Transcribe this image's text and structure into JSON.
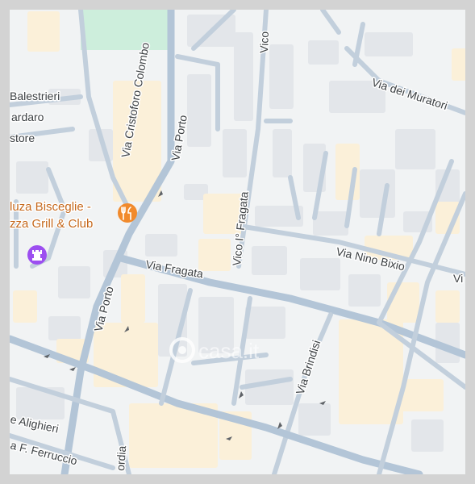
{
  "map": {
    "colors": {
      "background": "#f1f3f4",
      "park": "#cdeedc",
      "road": "#b3c5d7",
      "building": "#e3e6ea",
      "building_warm": "#fbf0d9",
      "poi_restaurant": "#f18a2c",
      "poi_purple": "#9c4ef0",
      "label": "#3c4043",
      "poi_label": "#c5681c",
      "frame": "#d3d3d3"
    },
    "streets": {
      "balestrieri": "Balestrieri",
      "cristoforo_colombo": "Via Cristoforo Colombo",
      "bardaro": "ardaro",
      "store": "store",
      "via_porto_upper": "Via Porto",
      "via_porto_lower": "Via Porto",
      "vico_upper": "Vico",
      "vico_fragata": "Vico I° Fragata",
      "via_dei_muratori": "Via dei Muratori",
      "via_fragata": "Via Fragata",
      "via_nino_bixio": "Via Nino Bixio",
      "right_edge_v": "Vi",
      "via_brindisi": "Via Brindisi",
      "alighieri": "e Alighieri",
      "ferruccio": "a F. Ferruccio",
      "cordia": "ordia"
    },
    "pois": {
      "restaurant_line1": "luza Bisceglie -",
      "restaurant_line2": "zza Grill & Club",
      "restaurant_icon": "fork-knife-icon",
      "purple_icon": "chess-rook-icon"
    },
    "watermark": "casa.it"
  }
}
